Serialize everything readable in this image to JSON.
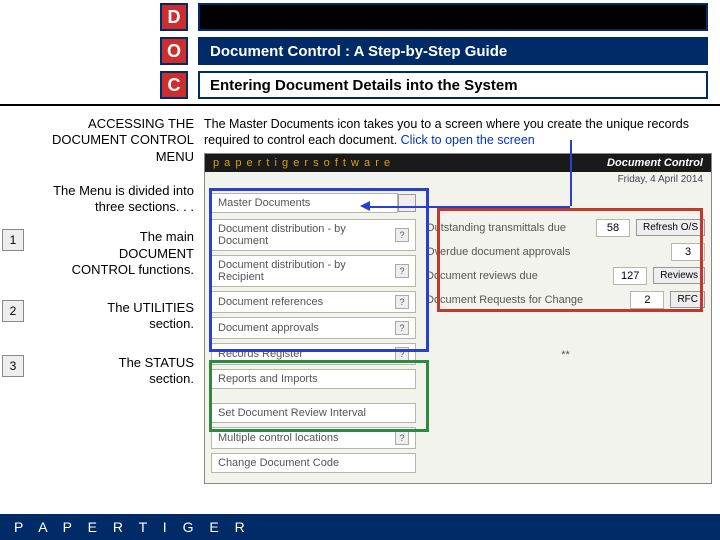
{
  "header": {
    "d": "D",
    "o": "O",
    "c": "C",
    "title1": "Document Control : A Step-by-Step Guide",
    "title2": "Entering Document Details into the System"
  },
  "left": {
    "access_l1": "ACCESSING THE",
    "access_l2": "DOCUMENT CONTROL",
    "access_l3": "MENU",
    "divided_l1": "The Menu is divided into",
    "divided_l2": "three sections. . .",
    "n1": "1",
    "n1_t1": "The main",
    "n1_t2": "DOCUMENT",
    "n1_t3": "CONTROL functions.",
    "n2": "2",
    "n2_t1": "The UTILITIES",
    "n2_t2": "section.",
    "n3": "3",
    "n3_t1": "The STATUS",
    "n3_t2": "section."
  },
  "intro": {
    "text": "The Master Documents icon takes you to a screen where you create the unique records required to control each document.  ",
    "link": "Click to open the screen"
  },
  "app": {
    "brand": "p a p e r   t i g e r   s o f t w a r e",
    "panel": "Document Control",
    "date": "Friday, 4 April 2014",
    "q": "?",
    "menu_a": [
      "Master Documents",
      "Document distribution - by Document",
      "Document distribution - by Recipient",
      "Document references",
      "Document approvals",
      "Records Register",
      "Reports and Imports"
    ],
    "menu_b": [
      "Set Document Review Interval",
      "Multiple control locations",
      "Change Document Code"
    ],
    "stats": [
      {
        "lbl": "Outstanding transmittals due",
        "val": "58",
        "btn": "Refresh O/S"
      },
      {
        "lbl": "Overdue document approvals",
        "val": "3",
        "btn": ""
      },
      {
        "lbl": "Document reviews due",
        "val": "127",
        "btn": "Reviews"
      },
      {
        "lbl": "Document Requests for Change",
        "val": "2",
        "btn": "RFC"
      }
    ],
    "stars": "**"
  },
  "footer": "P A P E R   T I G E R"
}
